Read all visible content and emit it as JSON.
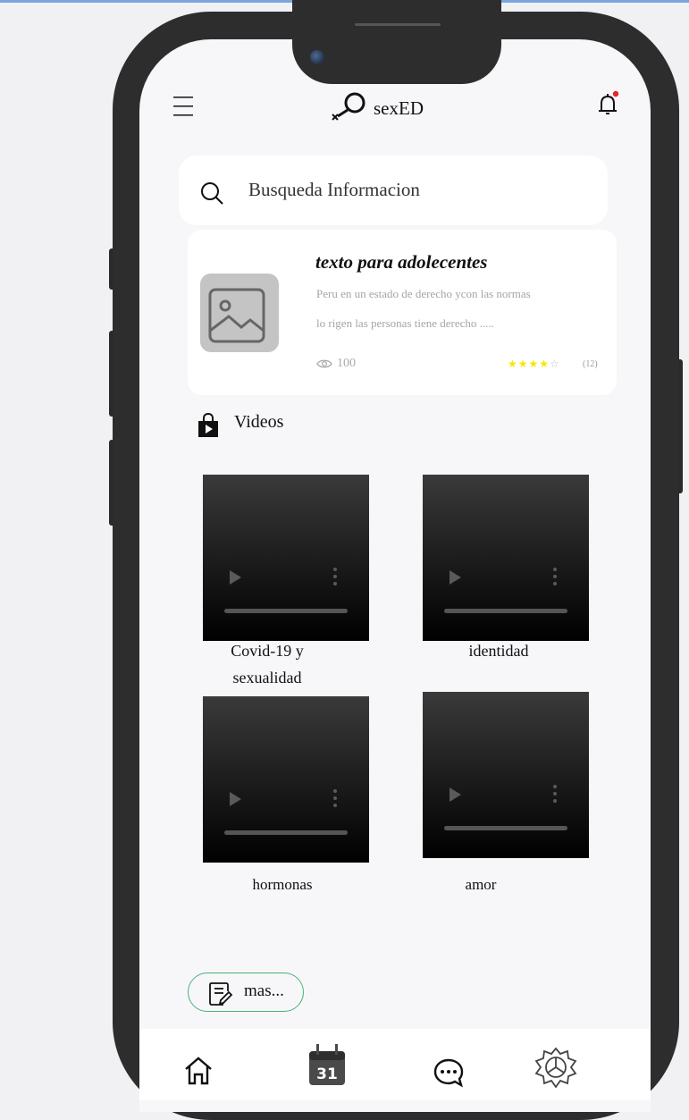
{
  "app": {
    "title": "sexED"
  },
  "search": {
    "placeholder": "Busqueda Informacion"
  },
  "featured": {
    "title": "texto para adolecentes",
    "line1": "Peru en un estado de derecho ycon las normas",
    "line2": "lo rigen las personas tiene derecho .....",
    "views": "100",
    "rating_stars": 4,
    "rating_max": 5,
    "rating_count": "(12)"
  },
  "videos_section": {
    "title": "Videos"
  },
  "videos": [
    {
      "caption_line1": "Covid-19 y",
      "caption_line2": "sexualidad"
    },
    {
      "caption_line1": "identidad",
      "caption_line2": ""
    },
    {
      "caption_line1": "hormonas",
      "caption_line2": ""
    },
    {
      "caption_line1": "amor",
      "caption_line2": ""
    }
  ],
  "more_button": {
    "label": "mas..."
  },
  "bottom_nav": {
    "calendar_day": "31"
  },
  "colors": {
    "notification_dot": "#e8222a",
    "star": "#f5e600",
    "more_border": "#46b37a"
  }
}
